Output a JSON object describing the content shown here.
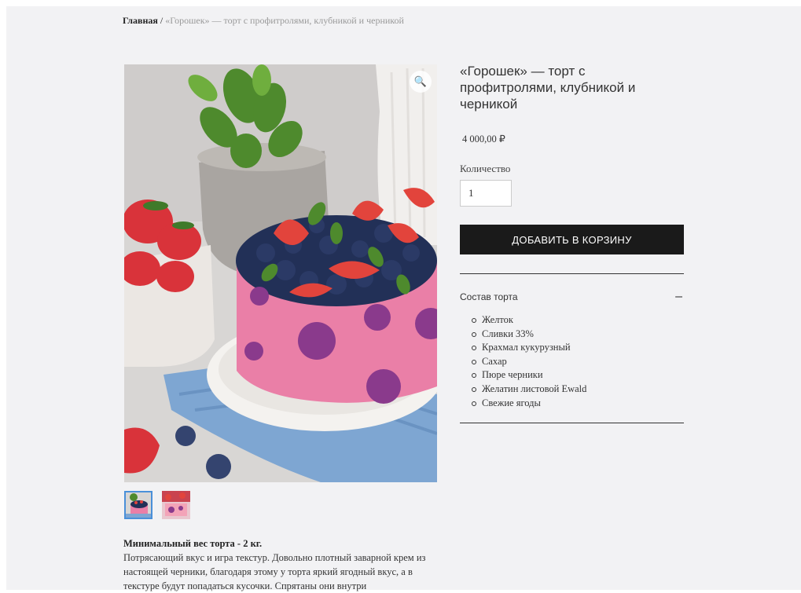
{
  "breadcrumb": {
    "home": "Главная",
    "separator": "/",
    "current": "«Горошек» — торт с профитролями, клубникой и черникой"
  },
  "product": {
    "title": "«Горошек» — торт с профитролями, клубникой и черникой",
    "price": "4 000,00 ₽",
    "quantity_label": "Количество",
    "quantity_value": "1",
    "add_to_cart_label": "ДОБАВИТЬ В КОРЗИНУ"
  },
  "gallery": {
    "zoom_icon": "magnifier-icon",
    "thumbnail_count": 2,
    "active_thumbnail": 1
  },
  "accordion": {
    "title": "Состав торта",
    "toggle_symbol": "–",
    "ingredients": [
      "Желток",
      "Сливки 33%",
      "Крахмал кукурузный",
      "Сахар",
      "Пюре черники",
      "Желатин листовой Ewald",
      "Свежие ягоды"
    ]
  },
  "description": {
    "weight_label": "Минимальный вес  торта - 2 кг.",
    "text": "Потрясающий вкус и игра текстур. Довольно плотный заварной крем из настоящей черники, благодаря этому у торта яркий ягодный вкус, а в текстуре будут попадаться кусочки. Спрятаны они внутри"
  },
  "colors": {
    "button_bg": "#1a1a1a",
    "page_bg": "#f2f2f4",
    "thumb_active_border": "#4a90d9"
  }
}
